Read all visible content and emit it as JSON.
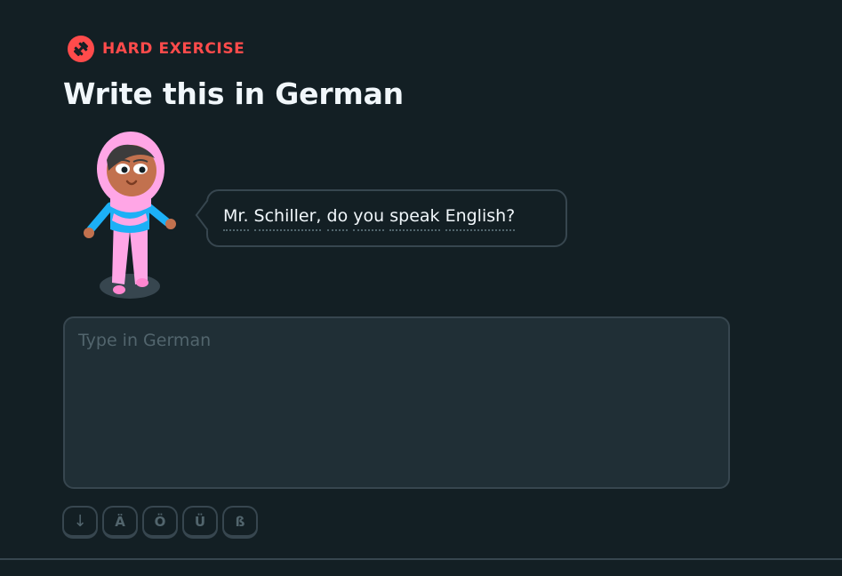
{
  "header": {
    "badge_label": "HARD EXERCISE",
    "badge_icon": "dumbbell-icon",
    "badge_color": "#ff4b4b",
    "title": "Write this in German"
  },
  "prompt": {
    "character": "hijab-girl-character",
    "words": [
      "Mr.",
      "Schiller,",
      "do",
      "you",
      "speak",
      "English?"
    ]
  },
  "answer": {
    "placeholder": "Type in German",
    "value": ""
  },
  "keyboard": {
    "keys": [
      "↓",
      "Ä",
      "Ö",
      "Ü",
      "ß"
    ]
  },
  "colors": {
    "background": "#131f24",
    "border": "#37464f",
    "input_background": "#202f36",
    "text": "#f1f7fb",
    "muted": "#52656d"
  }
}
